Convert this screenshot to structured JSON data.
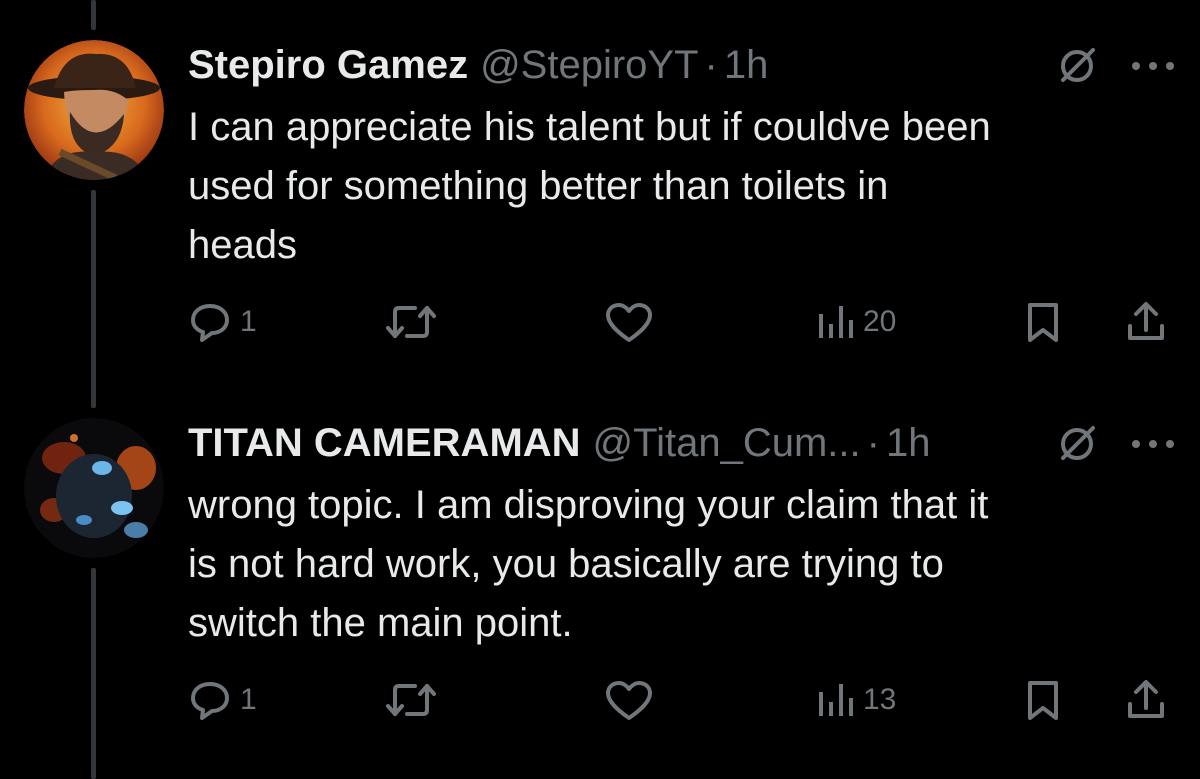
{
  "tweets": [
    {
      "name": "Stepiro Gamez",
      "handle": "@StepiroYT",
      "separator": "·",
      "time": "1h",
      "lines": [
        "I can appreciate his talent but if couldve been",
        "used for something better than toilets in",
        "heads"
      ],
      "actions": {
        "reply_count": "1",
        "retweet_count": "",
        "like_count": "",
        "views_count": "20"
      }
    },
    {
      "name": "TITAN CAMERAMAN",
      "handle": "@Titan_Cum...",
      "separator": "·",
      "time": "1h",
      "lines": [
        "wrong topic. I am disproving your claim that it",
        "is not hard work, you basically are trying to",
        "switch the main point."
      ],
      "actions": {
        "reply_count": "1",
        "retweet_count": "",
        "like_count": "",
        "views_count": "13"
      }
    }
  ],
  "colors": {
    "background": "#000000",
    "primary_text": "#e7e9ea",
    "secondary_text": "#71767b",
    "thread_line": "#333639"
  },
  "icons": [
    "grok-icon",
    "more-icon",
    "reply-icon",
    "retweet-icon",
    "like-icon",
    "views-icon",
    "bookmark-icon",
    "share-icon"
  ]
}
